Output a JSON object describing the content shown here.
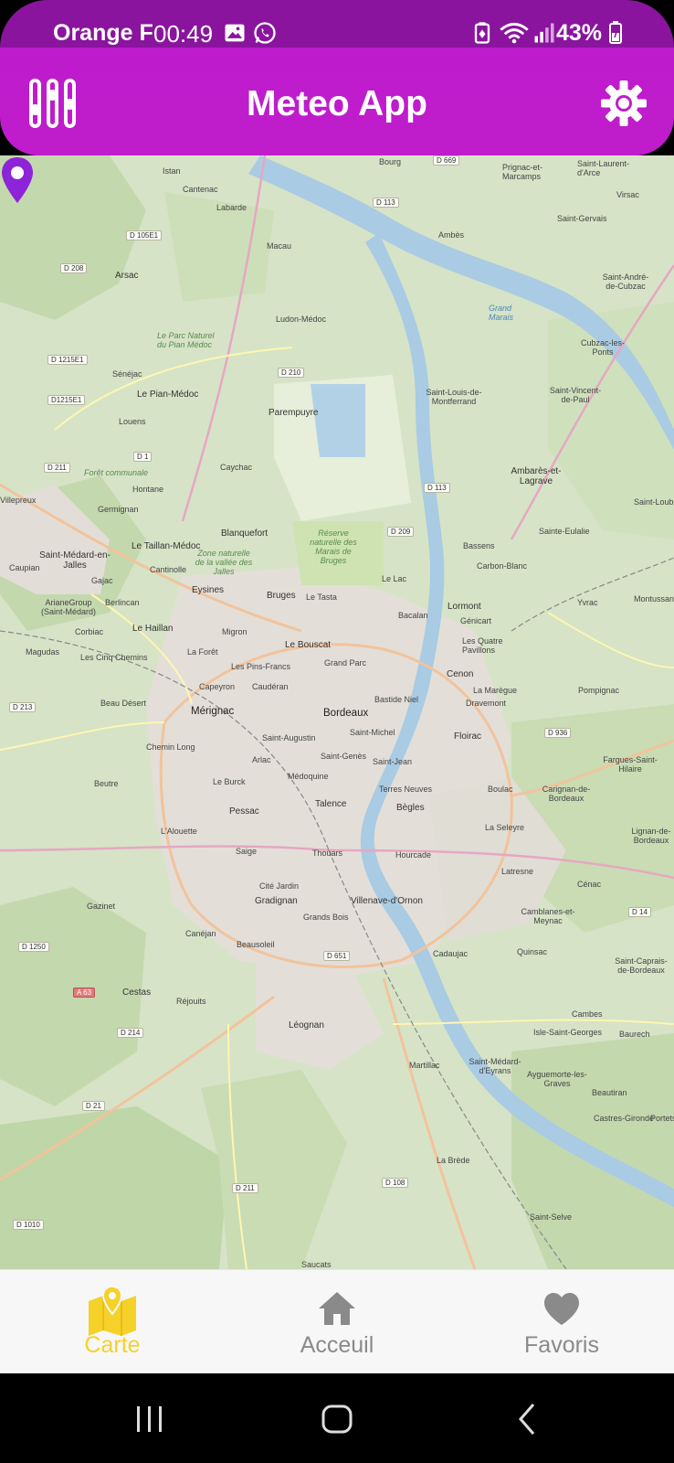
{
  "status_bar": {
    "carrier": "Orange F",
    "time": "00:49",
    "battery_percent": "43%",
    "icons": [
      "gallery-icon",
      "whatsapp-icon",
      "battery-saver-icon",
      "wifi-icon",
      "signal-icon",
      "battery-charging-icon"
    ]
  },
  "header": {
    "title": "Meteo App",
    "left_icon": "filter-sliders-icon",
    "right_icon": "settings-gear-icon",
    "color": "#c01ccc"
  },
  "map": {
    "selected_city": "Bordeaux",
    "pin_color": "#8e24d8",
    "labels": {
      "bourg": "Bourg",
      "prignac": "Prignac-et-Marcamps",
      "saint_laurent": "Saint-Laurent-d'Arce",
      "cantenac": "Cantenac",
      "labarde": "Labarde",
      "macau": "Macau",
      "ambes": "Ambès",
      "saint_gervais": "Saint-Gervais",
      "virsac": "Virsac",
      "arsac": "Arsac",
      "saint_andre": "Saint-André-de-Cubzac",
      "grand_marais": "Grand Marais",
      "ludon": "Ludon-Médoc",
      "cubzac": "Cubzac-les-Ponts",
      "senejac": "Sénéjac",
      "parc_pian": "Le Parc Naturel du Pian Médoc",
      "le_pian": "Le Pian-Médoc",
      "saint_louis": "Saint-Louis-de-Montferrand",
      "saint_vincent": "Saint-Vincent-de-Paul",
      "parempuyre": "Parempuyre",
      "louens": "Louens",
      "caychac": "Caychac",
      "ambares": "Ambarès-et-Lagrave",
      "foret": "Forêt communale",
      "hontane": "Hontane",
      "villepreux": "Villepreux",
      "saint_loubes": "Saint-Loubès",
      "germignan": "Germignan",
      "blanquefort": "Blanquefort",
      "reserve": "Réserve naturelle des Marais de Bruges",
      "sainte_eulalie": "Sainte-Eulalie",
      "taillan": "Le Taillan-Médoc",
      "bassens": "Bassens",
      "saint_medard": "Saint-Médard-en-Jalles",
      "cantinolle": "Cantinolle",
      "zone_jalles": "Zone naturelle de la vallée des Jalles",
      "carbon_blanc": "Carbon-Blanc",
      "gajac": "Gajac",
      "caupian": "Caupian",
      "berlincan": "Berlincan",
      "eysines": "Eysines",
      "bruges": "Bruges",
      "le_tasta": "Le Tasta",
      "le_lac": "Le Lac",
      "lormont": "Lormont",
      "yvrac": "Yvrac",
      "montussan": "Montussan",
      "arianegroup": "ArianeGroup (Saint-Médard)",
      "corbiac": "Corbiac",
      "le_haillan": "Le Haillan",
      "migron": "Migron",
      "bacalan": "Bacalan",
      "genicart": "Génicart",
      "magudas": "Magudas",
      "quatre_pavillons": "Les Quatre Pavillons",
      "cinq_chemins": "Les Cinq Chemins",
      "la_foret": "La Forêt",
      "le_bouscat": "Le Bouscat",
      "grand_parc": "Grand Parc",
      "pins_francs": "Les Pins-Francs",
      "cenon": "Cenon",
      "capeyron": "Capeyron",
      "cauderan": "Caudéran",
      "maregue": "La Marègue",
      "pompignac": "Pompignac",
      "beau_desert": "Beau Désert",
      "bastide": "Bastide Niel",
      "dravemont": "Dravemont",
      "merignac": "Mérignac",
      "bordeaux": "Bordeaux",
      "saint_michel": "Saint-Michel",
      "saint_augustin": "Saint-Augustin",
      "floirac": "Floirac",
      "chemin_long": "Chemin Long",
      "fargues": "Fargues-Saint-Hilaire",
      "arlac": "Arlac",
      "saint_genes": "Saint-Genès",
      "saint_jean": "Saint-Jean",
      "medoquine": "Médoquine",
      "beutre": "Beutre",
      "le_burck": "Le Burck",
      "terres_neuves": "Terres Neuves",
      "boulac": "Boulac",
      "carignan": "Carignan-de-Bordeaux",
      "talence": "Talence",
      "pessac": "Pessac",
      "begles": "Bègles",
      "lalouette": "L'Alouette",
      "la_seleyre": "La Seleyre",
      "lignan": "Lignan-de-Bordeaux",
      "saige": "Saige",
      "thouars": "Thouars",
      "hourcade": "Hourcade",
      "latresne": "Latresne",
      "cite_jardin": "Cité Jardin",
      "cenac": "Cénac",
      "gradignan": "Gradignan",
      "villenave": "Villenave-d'Ornon",
      "gazinet": "Gazinet",
      "camblanes": "Camblanes-et-Meynac",
      "canejan": "Canéjan",
      "grands_bois": "Grands Bois",
      "beausoleil": "Beausoleil",
      "cadaujac": "Cadaujac",
      "quinsac": "Quinsac",
      "saint_caprais": "Saint-Caprais-de-Bordeaux",
      "cestas": "Cestas",
      "rejouits": "Réjouits",
      "cambes": "Cambes",
      "leognan": "Léognan",
      "isle_saint_georges": "Isle-Saint-Georges",
      "baurech": "Baurech",
      "martillac": "Martillac",
      "saint_medard_eyrans": "Saint-Médard-d'Eyrans",
      "ayguemorte": "Ayguemorte-les-Graves",
      "beautiran": "Beautiran",
      "castres": "Castres-Gironde",
      "portets": "Portets",
      "la_brede": "La Brède",
      "saint_selve": "Saint-Selve",
      "saucats": "Saucats",
      "istan": "Istan"
    },
    "road_tags": {
      "d669": "D 669",
      "d113a": "D 113",
      "d105e1": "D 105E1",
      "d208": "D 208",
      "d1215e1a": "D 1215E1",
      "d1215e1b": "D1215E1",
      "d210": "D 210",
      "d1": "D 1",
      "d211a": "D 211",
      "d113b": "D 113",
      "d209": "D 209",
      "d213": "D 213",
      "d936": "D 936",
      "d14": "D 14",
      "d1250": "D 1250",
      "a63": "A 63",
      "d651": "D 651",
      "d214": "D 214",
      "d21": "D 21",
      "d211b": "D 211",
      "d108": "D 108",
      "d1010": "D 1010"
    }
  },
  "bottom_nav": {
    "items": [
      {
        "label": "Carte",
        "icon": "map-pin-icon",
        "active": true,
        "color": "#f5d12a"
      },
      {
        "label": "Acceuil",
        "icon": "home-icon",
        "active": false,
        "color": "#8a8a8a"
      },
      {
        "label": "Favoris",
        "icon": "heart-icon",
        "active": false,
        "color": "#8a8a8a"
      }
    ]
  },
  "system_nav": {
    "buttons": [
      "recent-apps-icon",
      "home-button-icon",
      "back-icon"
    ]
  }
}
